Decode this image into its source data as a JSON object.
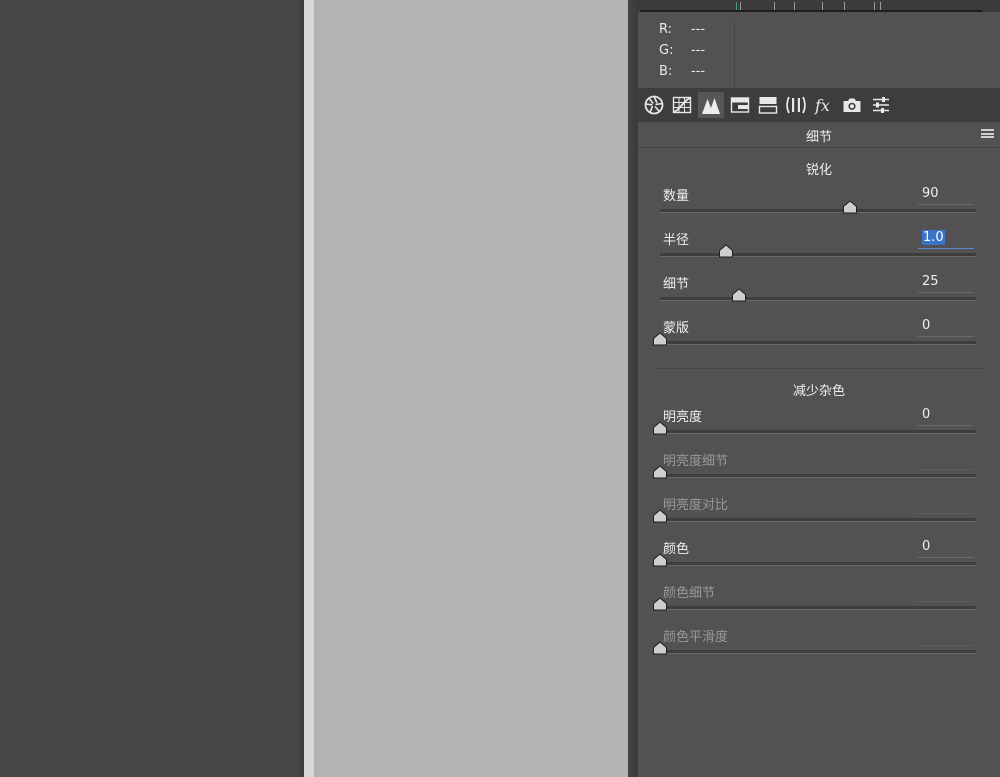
{
  "readout": {
    "rows": [
      {
        "channel": "R:",
        "value": "---"
      },
      {
        "channel": "G:",
        "value": "---"
      },
      {
        "channel": "B:",
        "value": "---"
      }
    ]
  },
  "toolbar": {
    "tools": [
      {
        "name": "basic-aperture-icon",
        "active": false
      },
      {
        "name": "tone-curve-grid-icon",
        "active": false
      },
      {
        "name": "detail-mountains-icon",
        "active": true
      },
      {
        "name": "hsl-icon",
        "active": false
      },
      {
        "name": "split-toning-icon",
        "active": false
      },
      {
        "name": "lens-corrections-icon",
        "active": false
      },
      {
        "name": "effects-fx-icon",
        "active": false
      },
      {
        "name": "camera-calibration-icon",
        "active": false
      },
      {
        "name": "presets-sliders-icon",
        "active": false
      }
    ]
  },
  "panel": {
    "title": "细节"
  },
  "sharpening": {
    "title": "锐化",
    "sliders": [
      {
        "label": "数量",
        "value": "90",
        "fraction": 0.6,
        "enabled": true,
        "focused": false
      },
      {
        "label": "半径",
        "value": "1.0",
        "fraction": 0.21,
        "enabled": true,
        "focused": true
      },
      {
        "label": "细节",
        "value": "25",
        "fraction": 0.25,
        "enabled": true,
        "focused": false
      },
      {
        "label": "蒙版",
        "value": "0",
        "fraction": 0.0,
        "enabled": true,
        "focused": false
      }
    ]
  },
  "noise": {
    "title": "减少杂色",
    "sliders": [
      {
        "label": "明亮度",
        "value": "0",
        "fraction": 0.0,
        "enabled": true,
        "focused": false
      },
      {
        "label": "明亮度细节",
        "value": "",
        "fraction": 0.0,
        "enabled": false,
        "focused": false
      },
      {
        "label": "明亮度对比",
        "value": "",
        "fraction": 0.0,
        "enabled": false,
        "focused": false
      },
      {
        "label": "颜色",
        "value": "0",
        "fraction": 0.0,
        "enabled": true,
        "focused": false
      },
      {
        "label": "颜色细节",
        "value": "",
        "fraction": 0.0,
        "enabled": false,
        "focused": false
      },
      {
        "label": "颜色平滑度",
        "value": "",
        "fraction": 0.0,
        "enabled": false,
        "focused": false
      }
    ]
  }
}
